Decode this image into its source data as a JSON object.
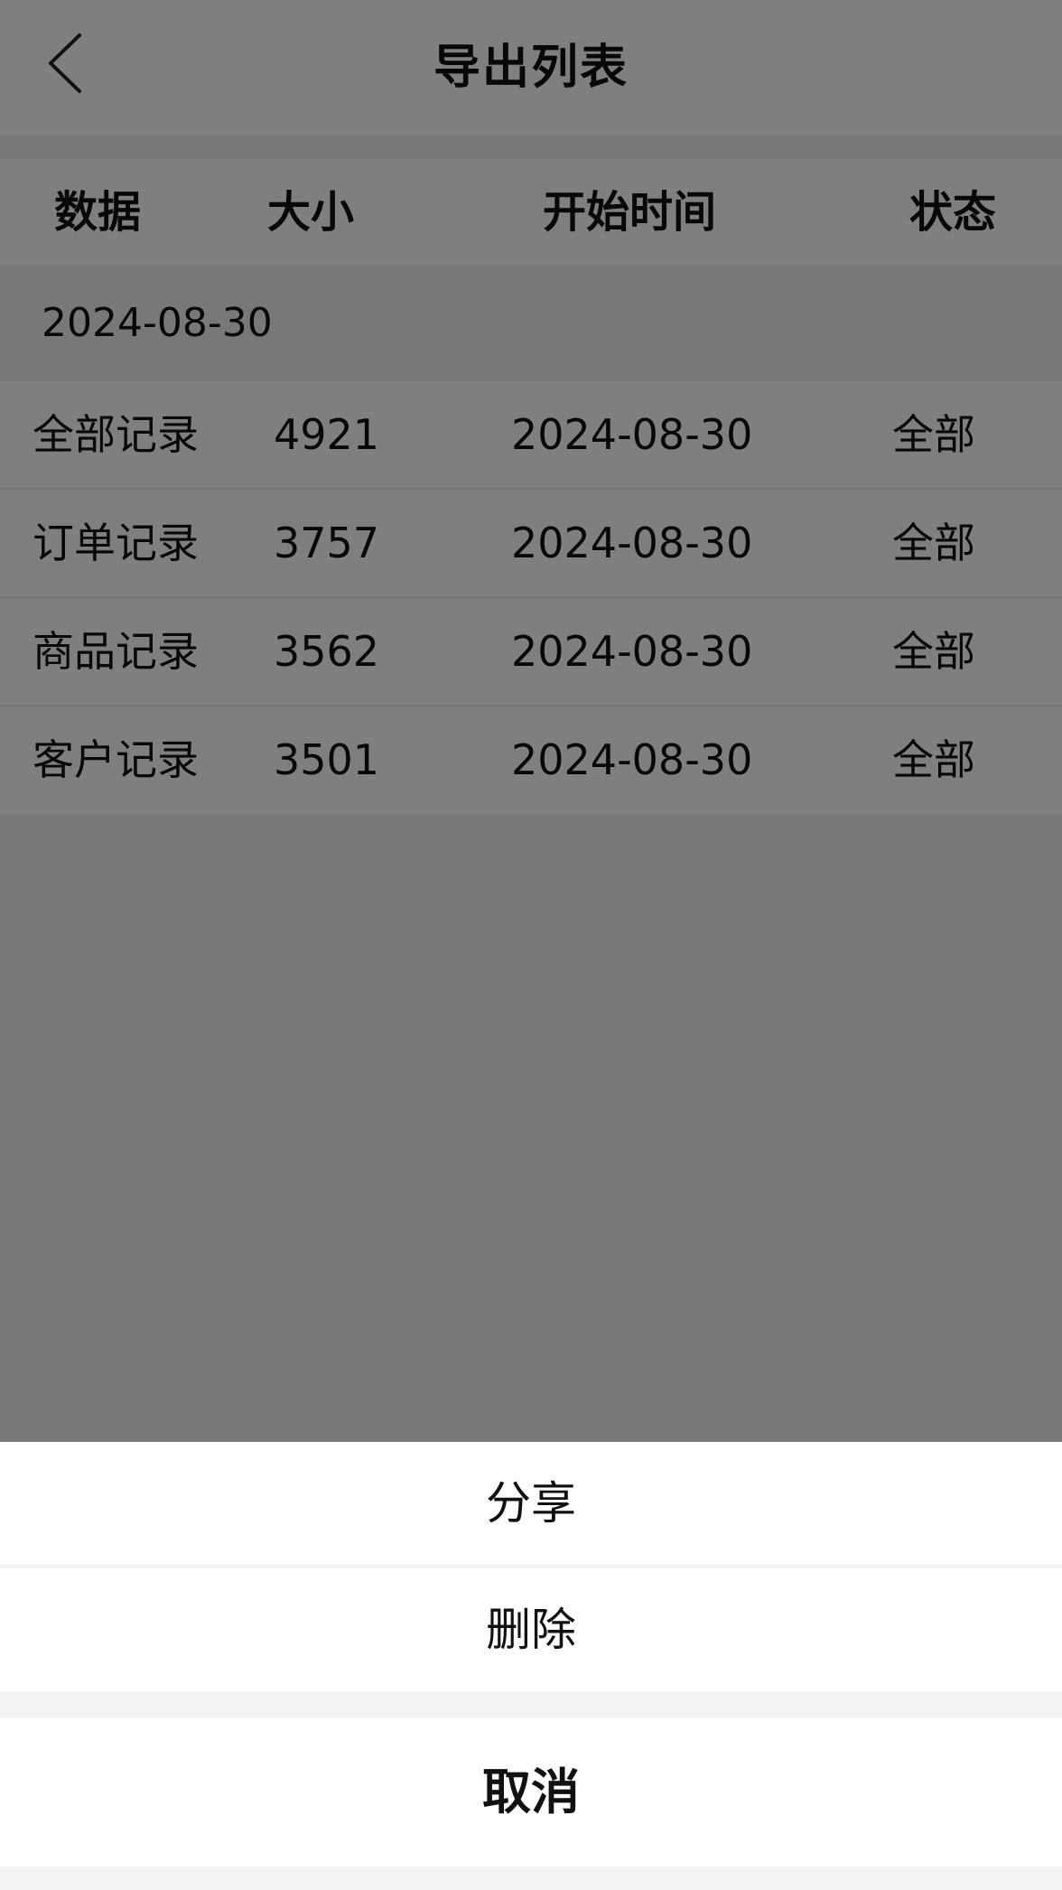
{
  "header": {
    "title": "导出列表",
    "back_icon": "chevron-left-icon"
  },
  "table": {
    "columns": [
      "数据",
      "大小",
      "开始时间",
      "状态"
    ],
    "group_date": "2024-08-30",
    "rows": [
      {
        "name": "全部记录",
        "size": "4921",
        "start": "2024-08-30",
        "status": "全部"
      },
      {
        "name": "订单记录",
        "size": "3757",
        "start": "2024-08-30",
        "status": "全部"
      },
      {
        "name": "商品记录",
        "size": "3562",
        "start": "2024-08-30",
        "status": "全部"
      },
      {
        "name": "客户记录",
        "size": "3501",
        "start": "2024-08-30",
        "status": "全部"
      }
    ]
  },
  "action_sheet": {
    "share_label": "分享",
    "delete_label": "删除",
    "cancel_label": "取消"
  },
  "colors": {
    "overlay": "#000000",
    "sheet_background": "#f3f3f5",
    "option_background": "#ffffff"
  }
}
